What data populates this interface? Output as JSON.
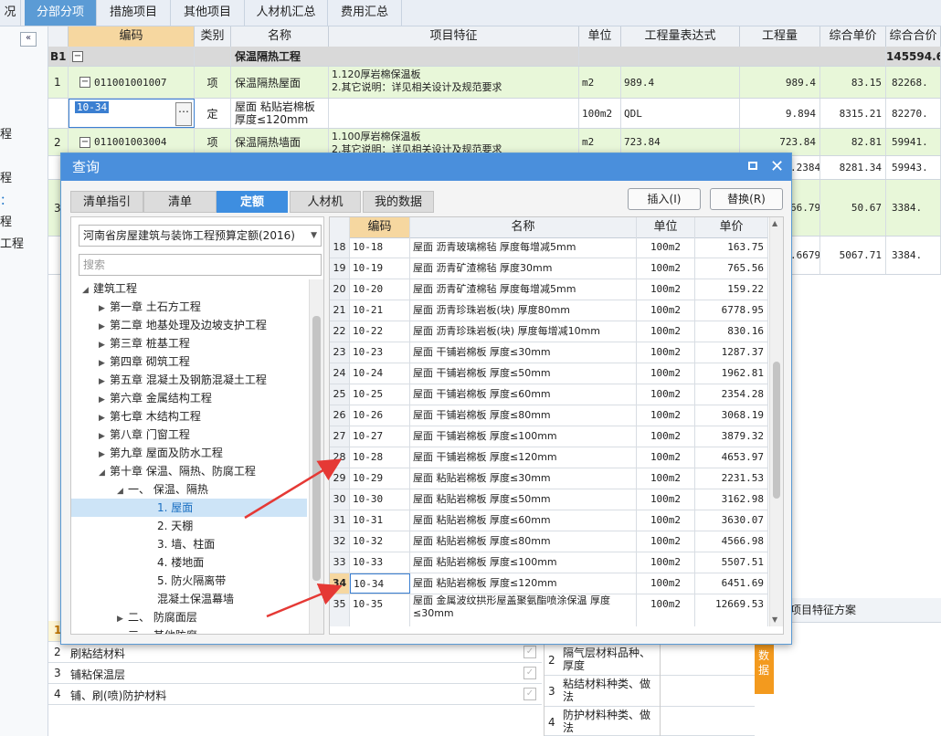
{
  "top_tabs": [
    "况",
    "分部分项",
    "措施项目",
    "其他项目",
    "人材机汇总",
    "费用汇总"
  ],
  "left_labels": [
    "程",
    "程",
    "程",
    "工程"
  ],
  "main_headers": [
    "编码",
    "类别",
    "名称",
    "项目特征",
    "单位",
    "工程量表达式",
    "工程量",
    "综合单价",
    "综合合价"
  ],
  "section_row": {
    "num": "B1",
    "name": "保温隔热工程",
    "total": "145594.6"
  },
  "rows": [
    {
      "num": "1",
      "code": "011001001007",
      "type": "项",
      "name": "保温隔热屋面",
      "feature1": "1.120厚岩棉保温板",
      "feature2": "2.其它说明：详见相关设计及规范要求",
      "unit": "m2",
      "expr": "989.4",
      "qty": "989.4",
      "price": "83.15",
      "total": "82268."
    },
    {
      "num": "",
      "code": "10-34",
      "type": "定",
      "name": "屋面 粘贴岩棉板 厚度≤120mm",
      "feature1": "",
      "feature2": "",
      "unit": "100m2",
      "expr": "QDL",
      "qty": "9.894",
      "price": "8315.21",
      "total": "82270."
    },
    {
      "num": "2",
      "code": "011001003004",
      "type": "项",
      "name": "保温隔热墙面",
      "feature1": "1.100厚岩棉保温板",
      "feature2": "2.其它说明：详见相关设计及规范要求",
      "unit": "m2",
      "expr": "723.84",
      "qty": "723.84",
      "price": "82.81",
      "total": "59941."
    }
  ],
  "partial_rows": [
    {
      "qty": ".2384",
      "price": "8281.34",
      "total": "59943."
    },
    {
      "num": "3",
      "qty": "66.79",
      "price": "50.67",
      "total": "3384."
    },
    {
      "qty": ".6679",
      "price": "5067.71",
      "total": "3384."
    }
  ],
  "dialog": {
    "title": "查询",
    "tabs": [
      "清单指引",
      "清单",
      "定额",
      "人材机",
      "我的数据"
    ],
    "insert": "插入(I)",
    "replace": "替换(R)",
    "combo": "河南省房屋建筑与装饰工程预算定额(2016)",
    "search_placeholder": "搜索",
    "tree": [
      {
        "label": "建筑工程",
        "tri": "◢"
      },
      {
        "label": "第一章 土石方工程",
        "tri": "▶"
      },
      {
        "label": "第二章 地基处理及边坡支护工程",
        "tri": "▶"
      },
      {
        "label": "第三章 桩基工程",
        "tri": "▶"
      },
      {
        "label": "第四章 砌筑工程",
        "tri": "▶"
      },
      {
        "label": "第五章 混凝土及钢筋混凝土工程",
        "tri": "▶"
      },
      {
        "label": "第六章 金属结构工程",
        "tri": "▶"
      },
      {
        "label": "第七章 木结构工程",
        "tri": "▶"
      },
      {
        "label": "第八章 门窗工程",
        "tri": "▶"
      },
      {
        "label": "第九章 屋面及防水工程",
        "tri": "▶"
      },
      {
        "label": "第十章 保温、隔热、防腐工程",
        "tri": "◢"
      },
      {
        "label": "一、 保温、隔热",
        "tri": "◢"
      },
      {
        "label": "1. 屋面",
        "tri": ""
      },
      {
        "label": "2. 天棚",
        "tri": ""
      },
      {
        "label": "3. 墙、柱面",
        "tri": ""
      },
      {
        "label": "4. 楼地面",
        "tri": ""
      },
      {
        "label": "5. 防火隔离带",
        "tri": ""
      },
      {
        "label": "混凝土保温幕墙",
        "tri": ""
      },
      {
        "label": "二、 防腐面层",
        "tri": "▶"
      },
      {
        "label": "三、 其他防腐",
        "tri": "▶"
      }
    ],
    "right_headers": [
      "编码",
      "名称",
      "单位",
      "单价"
    ],
    "right_rows": [
      {
        "n": "18",
        "code": "10-18",
        "name": "屋面 沥青玻璃棉毡 厚度每增减5mm",
        "unit": "100m2",
        "price": "163.75"
      },
      {
        "n": "19",
        "code": "10-19",
        "name": "屋面 沥青矿渣棉毡 厚度30mm",
        "unit": "100m2",
        "price": "765.56"
      },
      {
        "n": "20",
        "code": "10-20",
        "name": "屋面 沥青矿渣棉毡 厚度每增减5mm",
        "unit": "100m2",
        "price": "159.22"
      },
      {
        "n": "21",
        "code": "10-21",
        "name": "屋面 沥青珍珠岩板(块) 厚度80mm",
        "unit": "100m2",
        "price": "6778.95"
      },
      {
        "n": "22",
        "code": "10-22",
        "name": "屋面 沥青珍珠岩板(块) 厚度每增减10mm",
        "unit": "100m2",
        "price": "830.16"
      },
      {
        "n": "23",
        "code": "10-23",
        "name": "屋面 干铺岩棉板 厚度≤30mm",
        "unit": "100m2",
        "price": "1287.37"
      },
      {
        "n": "24",
        "code": "10-24",
        "name": "屋面 干铺岩棉板 厚度≤50mm",
        "unit": "100m2",
        "price": "1962.81"
      },
      {
        "n": "25",
        "code": "10-25",
        "name": "屋面 干铺岩棉板 厚度≤60mm",
        "unit": "100m2",
        "price": "2354.28"
      },
      {
        "n": "26",
        "code": "10-26",
        "name": "屋面 干铺岩棉板 厚度≤80mm",
        "unit": "100m2",
        "price": "3068.19"
      },
      {
        "n": "27",
        "code": "10-27",
        "name": "屋面 干铺岩棉板 厚度≤100mm",
        "unit": "100m2",
        "price": "3879.32"
      },
      {
        "n": "28",
        "code": "10-28",
        "name": "屋面 干铺岩棉板 厚度≤120mm",
        "unit": "100m2",
        "price": "4653.97"
      },
      {
        "n": "29",
        "code": "10-29",
        "name": "屋面 粘贴岩棉板 厚度≤30mm",
        "unit": "100m2",
        "price": "2231.53"
      },
      {
        "n": "30",
        "code": "10-30",
        "name": "屋面 粘贴岩棉板 厚度≤50mm",
        "unit": "100m2",
        "price": "3162.98"
      },
      {
        "n": "31",
        "code": "10-31",
        "name": "屋面 粘贴岩棉板 厚度≤60mm",
        "unit": "100m2",
        "price": "3630.07"
      },
      {
        "n": "32",
        "code": "10-32",
        "name": "屋面 粘贴岩棉板 厚度≤80mm",
        "unit": "100m2",
        "price": "4566.98"
      },
      {
        "n": "33",
        "code": "10-33",
        "name": "屋面 粘贴岩棉板 厚度≤100mm",
        "unit": "100m2",
        "price": "5507.51"
      },
      {
        "n": "34",
        "code": "10-34",
        "name": "屋面 粘贴岩棉板 厚度≤120mm",
        "unit": "100m2",
        "price": "6451.69"
      },
      {
        "n": "35",
        "code": "10-35",
        "name": "屋面 金属波纹拱形屋盖聚氨酯喷涂保温 厚度≤30mm",
        "unit": "100m2",
        "price": "12669.53"
      }
    ]
  },
  "bottom_left": [
    {
      "n": "1",
      "label": ""
    },
    {
      "n": "2",
      "label": "刷粘结材料"
    },
    {
      "n": "3",
      "label": "铺粘保温层"
    },
    {
      "n": "4",
      "label": "铺、刷(喷)防护材料"
    }
  ],
  "bottom_right": [
    {
      "n": "2",
      "label": "隔气层材料品种、厚度"
    },
    {
      "n": "3",
      "label": "粘结材料种类、做法"
    },
    {
      "n": "4",
      "label": "防护材料种类、做法"
    }
  ],
  "feature_scheme": "项目特征方案",
  "data_badge": "数据",
  "colors": {
    "accent": "#4a8fdc",
    "arrow": "#e53935",
    "green_row": "#e8f7d9",
    "orange_badge": "#f39a1e"
  }
}
